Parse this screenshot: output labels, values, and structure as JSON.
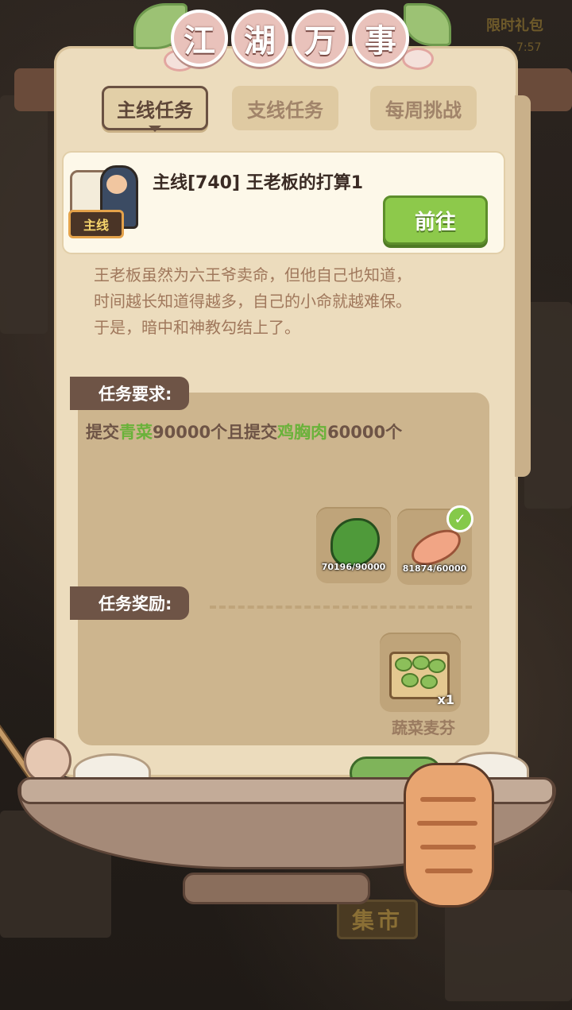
{
  "background": {
    "gift_label": "限时礼包",
    "gift_timer": "7:57",
    "market_sign": "集市"
  },
  "title": {
    "chars": [
      "江",
      "湖",
      "万",
      "事"
    ]
  },
  "tabs": [
    {
      "label": "主线任务",
      "active": true
    },
    {
      "label": "支线任务",
      "active": false
    },
    {
      "label": "每周挑战",
      "active": false
    }
  ],
  "task": {
    "badge": "主线",
    "title": "主线[740] 王老板的打算1",
    "go_button": "前往"
  },
  "description_lines": [
    "王老板虽然为六王爷卖命，但他自己也知道，",
    "时间越长知道得越多，自己的小命就越难保。",
    "于是，暗中和神教勾结上了。"
  ],
  "requirements": {
    "header": "任务要求:",
    "text_parts": [
      {
        "text": "提交",
        "highlight": false
      },
      {
        "text": "青菜",
        "highlight": true
      },
      {
        "text": "90000个且提交",
        "highlight": false
      },
      {
        "text": "鸡胸肉",
        "highlight": true
      },
      {
        "text": "60000个",
        "highlight": false
      }
    ],
    "items": [
      {
        "name": "青菜",
        "icon": "bok-choy-icon",
        "count": "70196/90000",
        "complete": false
      },
      {
        "name": "鸡胸肉",
        "icon": "chicken-breast-icon",
        "count": "81874/60000",
        "complete": true
      }
    ]
  },
  "rewards": {
    "header": "任务奖励:",
    "items": [
      {
        "name": "蔬菜麦芬",
        "icon": "vegetable-muffin-icon",
        "quantity": "x1"
      }
    ]
  },
  "colors": {
    "panel": "#ecdcbd",
    "highlight_green": "#6ab23a",
    "button_green": "#8dc94b",
    "section_tab": "#6e5446"
  }
}
